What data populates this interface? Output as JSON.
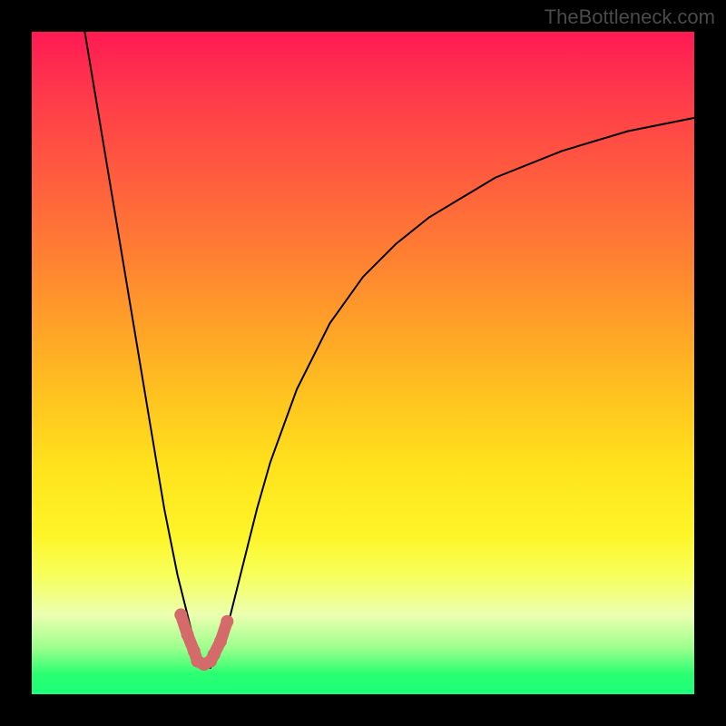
{
  "watermark": "TheBottleneck.com",
  "chart_data": {
    "type": "line",
    "title": "",
    "xlabel": "",
    "ylabel": "",
    "xlim": [
      0,
      100
    ],
    "ylim": [
      0,
      100
    ],
    "series": [
      {
        "name": "curve",
        "x": [
          8,
          10,
          12,
          14,
          16,
          18,
          20,
          22,
          24,
          25,
          26,
          27,
          28,
          30,
          32,
          34,
          36,
          40,
          45,
          50,
          55,
          60,
          70,
          80,
          90,
          100
        ],
        "y": [
          100,
          88,
          76,
          64,
          52,
          40,
          28,
          18,
          10,
          6,
          4,
          4,
          6,
          12,
          20,
          28,
          35,
          46,
          56,
          63,
          68,
          72,
          78,
          82,
          85,
          87
        ]
      },
      {
        "name": "highlight",
        "x": [
          22.5,
          23.5,
          24.5,
          25.0,
          26.0,
          27.0,
          27.5,
          28.5,
          29.5
        ],
        "y": [
          12,
          9,
          6.5,
          5,
          4.5,
          5,
          6,
          8,
          11
        ]
      }
    ],
    "gradient_stops": [
      {
        "pos": 0,
        "color": "#ff1a54"
      },
      {
        "pos": 50,
        "color": "#ffc31f"
      },
      {
        "pos": 80,
        "color": "#fdf528"
      },
      {
        "pos": 100,
        "color": "#1bff7a"
      }
    ],
    "highlight_color": "#d46a6a",
    "curve_color": "#000000"
  }
}
